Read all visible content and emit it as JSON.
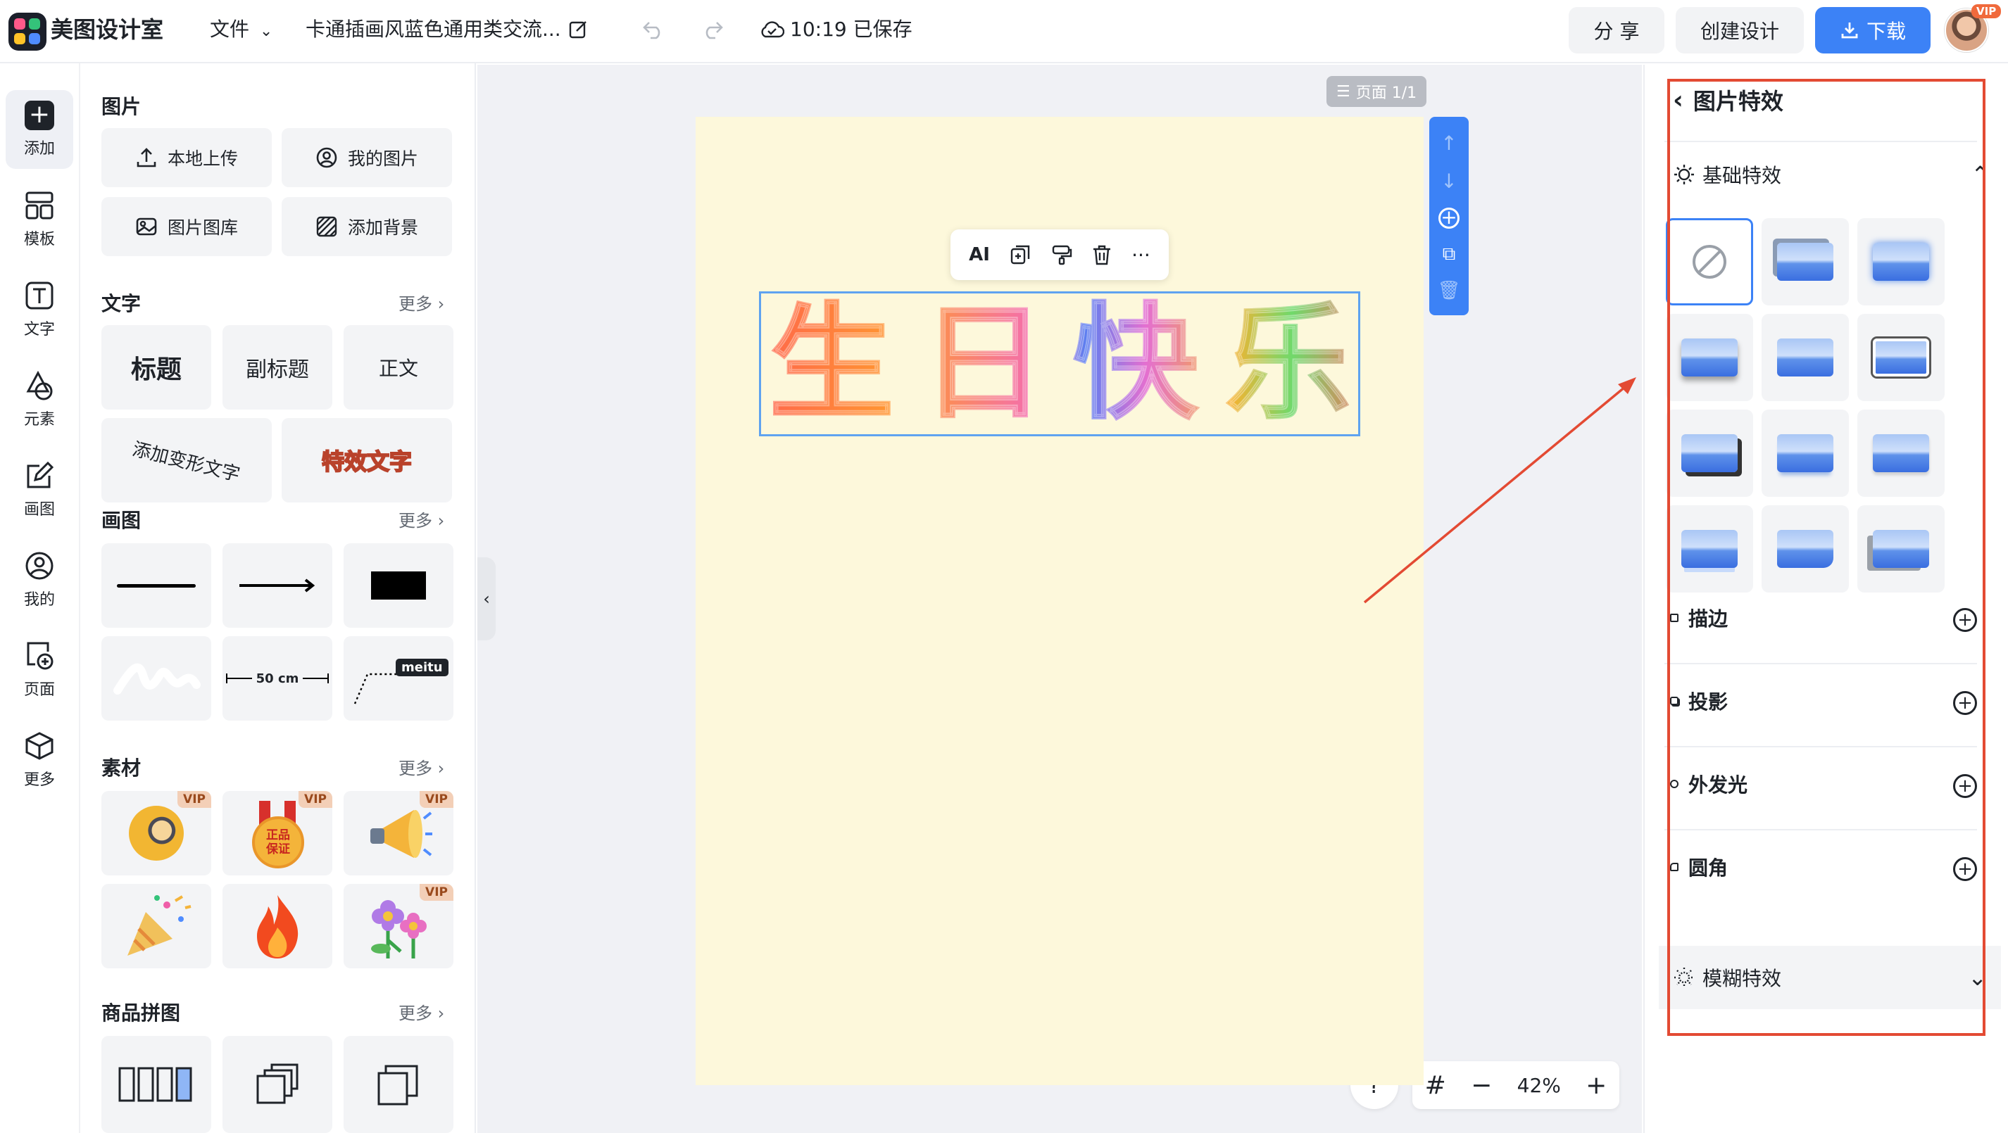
{
  "app": {
    "brand": "美图设计室"
  },
  "topbar": {
    "file_menu": "文件",
    "doc_title": "卡通插画风蓝色通用类交流...",
    "save_status": "10:19 已保存",
    "share": "分 享",
    "create": "创建设计",
    "download": "下载",
    "avatar_badge": "VIP"
  },
  "leftnav": {
    "items": [
      {
        "label": "添加",
        "icon": "plus-icon"
      },
      {
        "label": "模板",
        "icon": "template-icon"
      },
      {
        "label": "文字",
        "icon": "text-icon"
      },
      {
        "label": "元素",
        "icon": "shapes-icon"
      },
      {
        "label": "画图",
        "icon": "draw-icon"
      },
      {
        "label": "我的",
        "icon": "user-icon"
      },
      {
        "label": "页面",
        "icon": "page-add-icon"
      },
      {
        "label": "更多",
        "icon": "box-icon"
      }
    ]
  },
  "assets": {
    "images": {
      "title": "图片",
      "buttons": [
        "本地上传",
        "我的图片",
        "图片图库",
        "添加背景"
      ]
    },
    "text": {
      "title": "文字",
      "more": "更多",
      "items": [
        "标题",
        "副标题",
        "正文",
        "添加变形文字",
        "特效文字"
      ]
    },
    "drawing": {
      "title": "画图",
      "more": "更多",
      "measure_label": "50 cm",
      "tag_label": "meitu"
    },
    "material": {
      "title": "素材",
      "more": "更多",
      "vip_badge": "VIP",
      "medal_text": "正品保证"
    },
    "collage": {
      "title": "商品拼图",
      "more": "更多"
    }
  },
  "canvas": {
    "page_indicator": "页面 1/1",
    "text_toolbar_ai": "AI",
    "headline": "生日快乐",
    "zoom": "42%",
    "help": "?"
  },
  "panel": {
    "title": "图片特效",
    "basic_section": "基础特效",
    "options": [
      "描边",
      "投影",
      "外发光",
      "圆角"
    ],
    "blur_section": "模糊特效"
  },
  "colors": {
    "accent": "#3c82f6",
    "annotation": "#e34a33",
    "page_bg": "#fdf8db",
    "selection": "#5fa3f0"
  }
}
